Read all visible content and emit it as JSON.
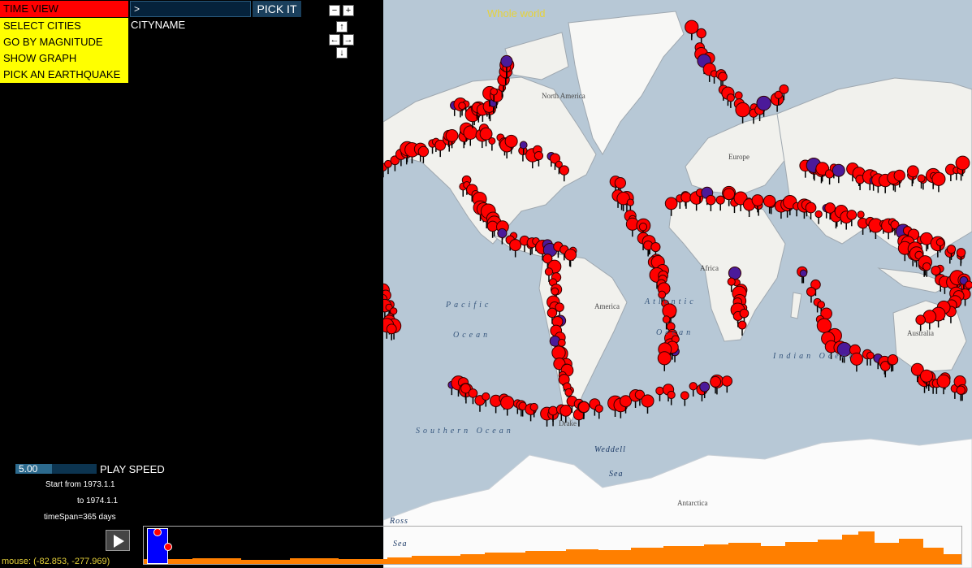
{
  "menu": {
    "time_view": "TIME VIEW",
    "select_cities": "SELECT CITIES",
    "go_by_magnitude": "GO BY MAGNITUDE",
    "show_graph": "SHOW GRAPH",
    "pick_earthquake": "PICK AN EARTHQUAKE"
  },
  "search": {
    "value": ">",
    "button_label": "PICK IT",
    "cityname_label": "CITYNAME"
  },
  "map_controls": {
    "zoom_out": "−",
    "zoom_in": "+",
    "up": "↑",
    "left": "←",
    "right": "→",
    "down": "↓"
  },
  "map": {
    "title": "Whole world",
    "labels": {
      "north_america": "North America",
      "europe": "Europe",
      "africa": "Africa",
      "america": "America",
      "australia": "Australia",
      "antarctica": "Antarctica",
      "pacific": "Pacific",
      "ocean_pacific": "Ocean",
      "atlantic": "Atlantic",
      "ocean_atlantic": "Ocean",
      "indian_ocean": "Indian Ocean",
      "southern_ocean": "Southern Ocean",
      "weddell": "Weddell",
      "sea_weddell": "Sea",
      "ross": "Ross",
      "sea_ross": "Sea",
      "drake": "Drake"
    },
    "colors": {
      "water": "#b7c8d6",
      "land": "#f1f1ed",
      "ice": "#ffffff",
      "quake_shallow": "#ff0000",
      "quake_deep": "#4b1a9a"
    }
  },
  "play": {
    "speed_value": "5.00",
    "speed_fraction": 0.45,
    "speed_label": "PLAY SPEED",
    "start_text": "Start from 1973.1.1",
    "end_text": "to 1974.1.1",
    "timespan_text": "timeSpan=365 days"
  },
  "mouse": {
    "readout": "mouse: (-82.853, -277.969)"
  },
  "colors": {
    "menu_active": "#ff0000",
    "menu_item": "#ffff00",
    "timeline_window": "#0000ff",
    "histogram": "#ff7f00"
  }
}
